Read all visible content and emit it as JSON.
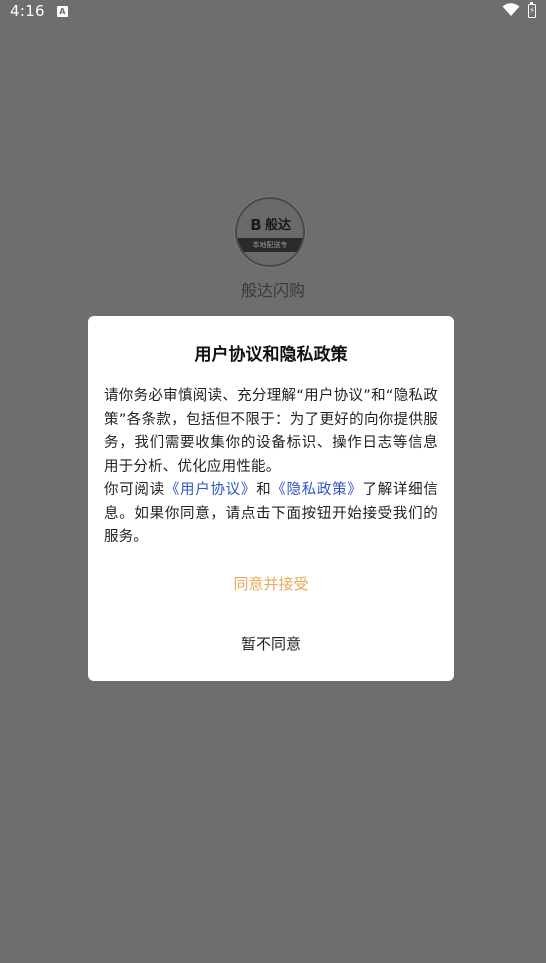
{
  "status_bar": {
    "time": "4:16",
    "notification_icon": "a-letter-icon",
    "wifi_icon": "wifi-icon",
    "battery_icon": "battery-charging-icon"
  },
  "splash": {
    "logo_mark": "B",
    "logo_text": "般达",
    "logo_band_text": "本地配送专",
    "app_name": "般达闪购"
  },
  "dialog": {
    "title": "用户协议和隐私政策",
    "body_part1": "请你务必审慎阅读、充分理解“用户协议”和“隐私政策”各条款，包括但不限于：为了更好的向你提供服务，我们需要收集你的设备标识、操作日志等信息用于分析、优化应用性能。",
    "body_part2_prefix": "你可阅读",
    "link_user_agreement": "《用户协议》",
    "body_and": "和",
    "link_privacy_policy": "《隐私政策》",
    "body_part2_suffix": "了解详细信息。如果你同意，请点击下面按钮开始接受我们的服务。",
    "agree_label": "同意并接受",
    "decline_label": "暂不同意"
  },
  "colors": {
    "overlay": "#6e6e6e",
    "link": "#2f54c9",
    "agree": "#e8a95a"
  }
}
